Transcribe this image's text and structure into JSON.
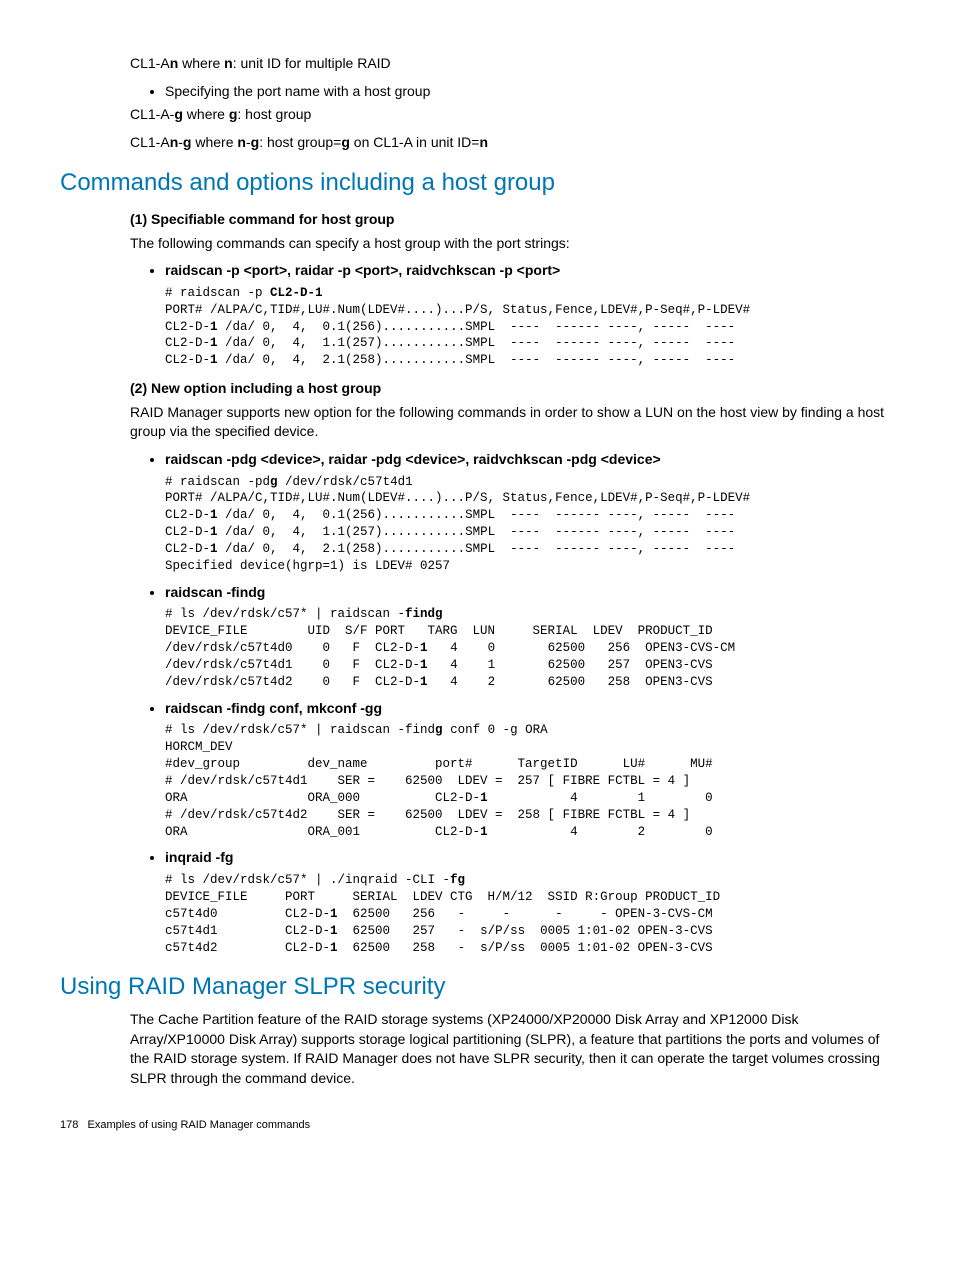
{
  "top": {
    "line1_pre": "CL1-A",
    "line1_bold": "n",
    "line1_mid": " where ",
    "line1_bold2": "n",
    "line1_post": ": unit ID for multiple RAID",
    "bullet1": "Specifying the port name with a host group",
    "line2_pre": "CL1-A-",
    "line2_bold": "g",
    "line2_mid": " where ",
    "line2_bold2": "g",
    "line2_post": ": host group",
    "line3_pre": "CL1-A",
    "line3_b1": "n",
    "line3_dash": "-",
    "line3_b2": "g",
    "line3_mid": " where ",
    "line3_b3": "n",
    "line3_dash2": "-",
    "line3_b4": "g",
    "line3_post": ": host group=",
    "line3_b5": "g",
    "line3_post2": " on CL1-A in unit ID=",
    "line3_b6": "n"
  },
  "sec1": {
    "title": "Commands and options including a host group",
    "sub1": "(1) Specifiable command for host group",
    "para1": "The following commands can specify a host group with the port strings:",
    "item1": "raidscan -p <port>, raidar -p <port>, raidvchkscan -p <port>",
    "code1_l1a": "# raidscan -p ",
    "code1_l1b": "CL2-D-1",
    "code1_l2": "PORT# /ALPA/C,TID#,LU#.Num(LDEV#....)...P/S, Status,Fence,LDEV#,P-Seq#,P-LDEV#",
    "code1_l3a": "CL2-D-",
    "code1_l3b": "1",
    "code1_l3c": " /da/ 0,  4,  0.1(256)...........SMPL  ----  ------ ----, -----  ----",
    "code1_l4c": " /da/ 0,  4,  1.1(257)...........SMPL  ----  ------ ----, -----  ----",
    "code1_l5c": " /da/ 0,  4,  2.1(258)...........SMPL  ----  ------ ----, -----  ----",
    "sub2": "(2) New option including a host group",
    "para2": "RAID Manager supports new option for the following commands in order to show a LUN on the host view by finding a host group via the specified device.",
    "item2": "raidscan -pdg <device>, raidar -pdg <device>, raidvchkscan -pdg <device>",
    "code2_l1a": "# raidscan -pd",
    "code2_l1b": "g",
    "code2_l1c": " /dev/rdsk/c57t4d1",
    "code2_last": "Specified device(hgrp=1) is LDEV# 0257",
    "item3": "raidscan -findg",
    "code3_l1a": "# ls /dev/rdsk/c57* | raidscan -",
    "code3_l1b": "findg",
    "code3_l2": "DEVICE_FILE        UID  S/F PORT   TARG  LUN     SERIAL  LDEV  PRODUCT_ID",
    "code3_l3a": "/dev/rdsk/c57t4d0    0   F  CL2-D-",
    "code3_l3b": "1",
    "code3_r0": "   4    0       62500   256  OPEN3-CVS-CM",
    "code3_r1": "   4    1       62500   257  OPEN3-CVS",
    "code3_r2": "   4    2       62500   258  OPEN3-CVS",
    "code3_d1": "/dev/rdsk/c57t4d1    0   F  CL2-D-",
    "code3_d2": "/dev/rdsk/c57t4d2    0   F  CL2-D-",
    "item4": "raidscan -findg conf, mkconf -gg",
    "code4_l1a": "# ls /dev/rdsk/c57* | raidscan -find",
    "code4_l1b": "g",
    "code4_l1c": " conf 0 -g ORA",
    "code4_l2": "HORCM_DEV",
    "code4_l3": "#dev_group         dev_name         port#      TargetID      LU#      MU#",
    "code4_l4": "# /dev/rdsk/c57t4d1    SER =    62500  LDEV =  257 [ FIBRE FCTBL = 4 ]",
    "code4_l5a": "ORA                ORA_000          CL2-D-",
    "code4_l5b": "1",
    "code4_l5c": "           4        1        0",
    "code4_l6": "# /dev/rdsk/c57t4d2    SER =    62500  LDEV =  258 [ FIBRE FCTBL = 4 ]",
    "code4_l7c": "           4        2        0",
    "code4_l7a": "ORA                ORA_001          CL2-D-",
    "item5": "inqraid -fg",
    "code5_l1a": "# ls /dev/rdsk/c57* | ./inqraid -CLI -",
    "code5_l1b": "fg",
    "code5_l2": "DEVICE_FILE     PORT     SERIAL  LDEV CTG  H/M/12  SSID R:Group PRODUCT_ID",
    "code5_r0a": "c57t4d0         CL2-D-",
    "code5_r0b": "1",
    "code5_r0c": "  62500   256   -     -      -     - OPEN-3-CVS-CM",
    "code5_r1c": "  62500   257   -  s/P/ss  0005 1:01-02 OPEN-3-CVS",
    "code5_r2c": "  62500   258   -  s/P/ss  0005 1:01-02 OPEN-3-CVS",
    "code5_r1a": "c57t4d1         CL2-D-",
    "code5_r2a": "c57t4d2         CL2-D-"
  },
  "sec2": {
    "title": "Using RAID Manager SLPR security",
    "para": "The Cache Partition feature of the RAID storage systems (XP24000/XP20000 Disk Array and XP12000 Disk Array/XP10000 Disk Array) supports storage logical partitioning (SLPR), a feature that partitions the ports and volumes of the RAID storage system. If RAID Manager does not have SLPR security, then it can operate the target volumes crossing SLPR through the command device."
  },
  "footer": {
    "page": "178",
    "text": "Examples of using RAID Manager commands"
  }
}
